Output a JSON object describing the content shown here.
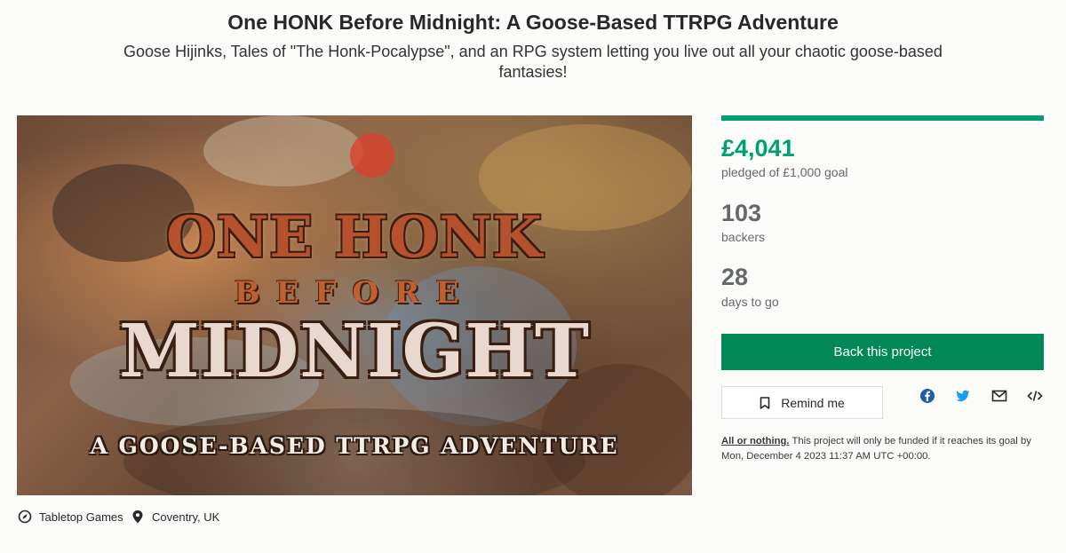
{
  "project": {
    "title": "One HONK Before Midnight: A Goose-Based TTRPG Adventure",
    "subtitle": "Goose Hijinks, Tales of \"The Honk-Pocalypse\", and an RPG system letting you live out all your chaotic goose-based fantasies!"
  },
  "hero": {
    "logo_line1": "ONE HONK",
    "logo_line2": "BEFORE",
    "logo_line3": "MIDNIGHT",
    "logo_line4": "A GOOSE-BASED TTRPG ADVENTURE"
  },
  "meta": {
    "category": "Tabletop Games",
    "category_icon": "compass-icon",
    "location": "Coventry, UK",
    "location_icon": "map-pin-icon"
  },
  "stats": {
    "progress_fraction": 1.0,
    "pledged": "£4,041",
    "pledged_label": "pledged of £1,000 goal",
    "backers": "103",
    "backers_label": "backers",
    "days": "28",
    "days_label": "days to go"
  },
  "actions": {
    "back_label": "Back this project",
    "remind_label": "Remind me",
    "share_icons": [
      "facebook-icon",
      "twitter-icon",
      "mail-icon",
      "embed-icon"
    ]
  },
  "fine_print": {
    "aon_label": "All or nothing.",
    "text": " This project will only be funded if it reaches its goal by Mon, December 4 2023 11:37 AM UTC +00:00."
  },
  "colors": {
    "accent_green": "#009e74",
    "button_green": "#028858",
    "text_gray": "#656969"
  }
}
